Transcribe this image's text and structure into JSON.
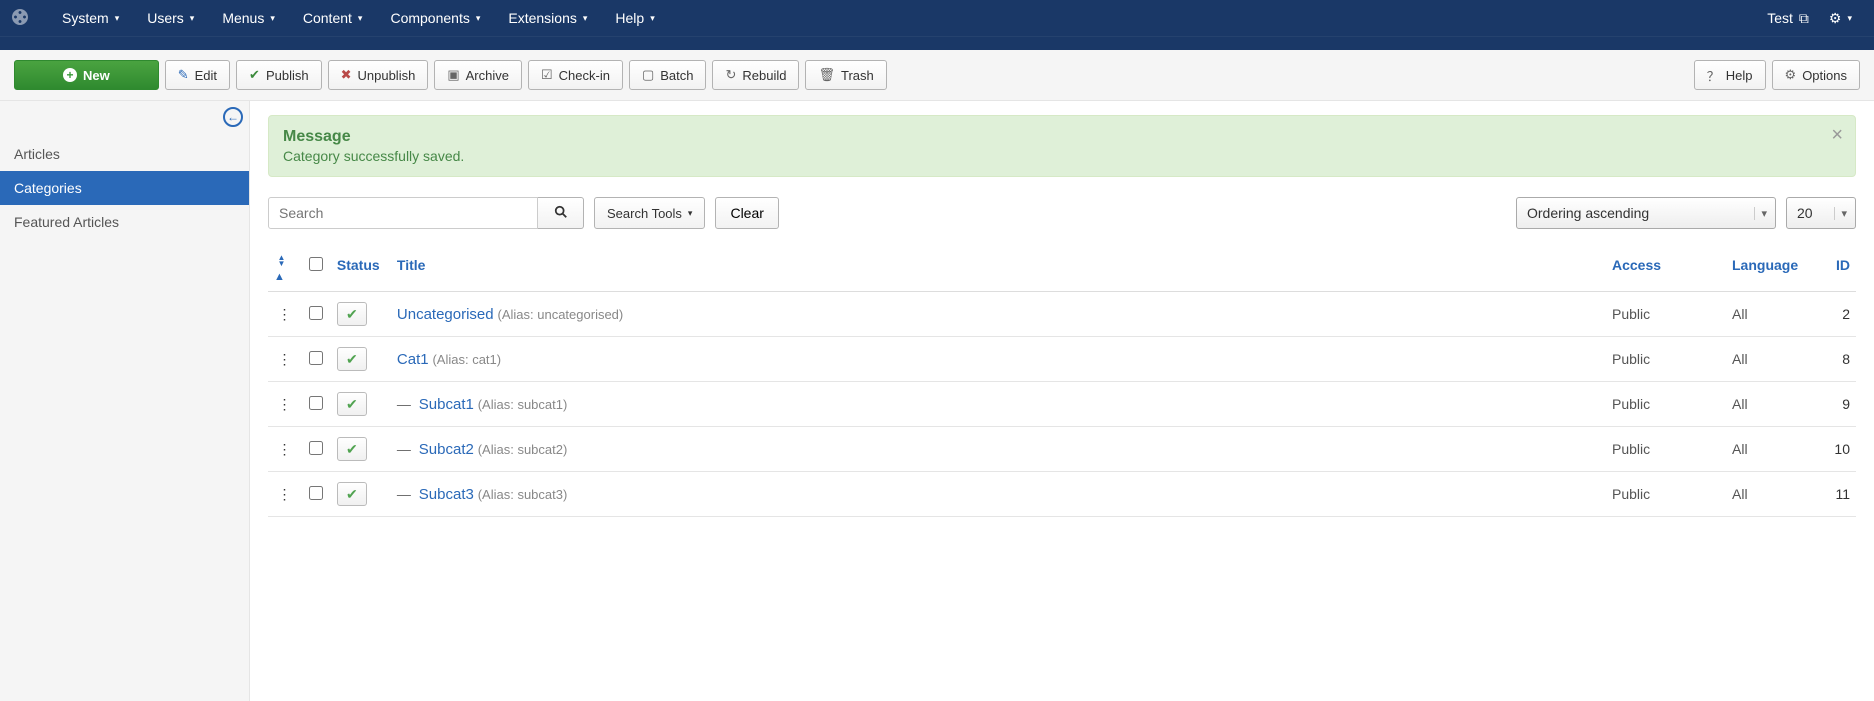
{
  "topnav": {
    "items": [
      "System",
      "Users",
      "Menus",
      "Content",
      "Components",
      "Extensions",
      "Help"
    ],
    "right_label": "Test"
  },
  "toolbar": {
    "new": "New",
    "edit": "Edit",
    "publish": "Publish",
    "unpublish": "Unpublish",
    "archive": "Archive",
    "checkin": "Check-in",
    "batch": "Batch",
    "rebuild": "Rebuild",
    "trash": "Trash",
    "help": "Help",
    "options": "Options"
  },
  "sidebar": {
    "items": [
      "Articles",
      "Categories",
      "Featured Articles"
    ],
    "active_index": 1
  },
  "alert": {
    "title": "Message",
    "body": "Category successfully saved."
  },
  "filter": {
    "search_placeholder": "Search",
    "search_tools": "Search Tools",
    "clear": "Clear",
    "ordering": "Ordering ascending",
    "limit": "20"
  },
  "table": {
    "headers": {
      "status": "Status",
      "title": "Title",
      "access": "Access",
      "language": "Language",
      "id": "ID"
    },
    "rows": [
      {
        "indent": 0,
        "title": "Uncategorised",
        "alias": "uncategorised",
        "access": "Public",
        "language": "All",
        "id": "2"
      },
      {
        "indent": 0,
        "title": "Cat1",
        "alias": "cat1",
        "access": "Public",
        "language": "All",
        "id": "8"
      },
      {
        "indent": 1,
        "title": "Subcat1",
        "alias": "subcat1",
        "access": "Public",
        "language": "All",
        "id": "9"
      },
      {
        "indent": 1,
        "title": "Subcat2",
        "alias": "subcat2",
        "access": "Public",
        "language": "All",
        "id": "10"
      },
      {
        "indent": 1,
        "title": "Subcat3",
        "alias": "subcat3",
        "access": "Public",
        "language": "All",
        "id": "11"
      }
    ]
  }
}
